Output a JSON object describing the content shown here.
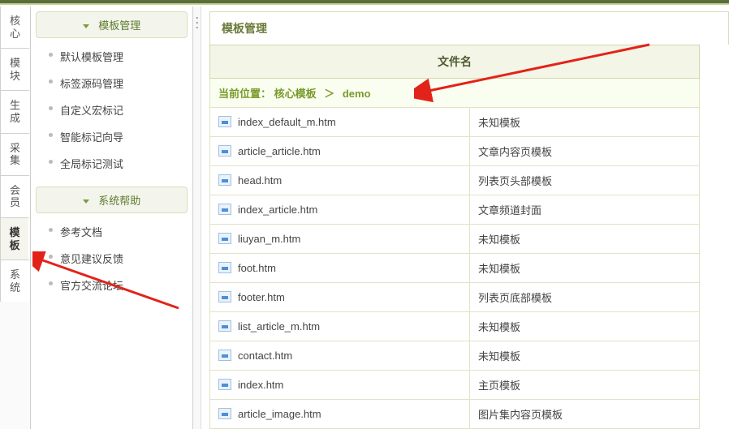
{
  "leftTabs": [
    "核心",
    "模块",
    "生成",
    "采集",
    "会员",
    "模板",
    "系统"
  ],
  "leftActiveIndex": 5,
  "templateMenu": {
    "title": "模板管理",
    "items": [
      "默认模板管理",
      "标签源码管理",
      "自定义宏标记",
      "智能标记向导",
      "全局标记测试"
    ]
  },
  "helpMenu": {
    "title": "系统帮助",
    "items": [
      "参考文档",
      "意见建议反馈",
      "官方交流论坛"
    ]
  },
  "pageTitle": "模板管理",
  "tableHeaders": [
    "文件名"
  ],
  "breadcrumb": {
    "prefix": "当前位置：",
    "parts": [
      "核心模板",
      "demo"
    ],
    "sep": "＞"
  },
  "files": [
    {
      "name": "index_default_m.htm",
      "desc": "未知模板"
    },
    {
      "name": "article_article.htm",
      "desc": "文章内容页模板"
    },
    {
      "name": "head.htm",
      "desc": "列表页头部模板"
    },
    {
      "name": "index_article.htm",
      "desc": "文章频道封面"
    },
    {
      "name": "liuyan_m.htm",
      "desc": "未知模板"
    },
    {
      "name": "foot.htm",
      "desc": "未知模板"
    },
    {
      "name": "footer.htm",
      "desc": "列表页底部模板"
    },
    {
      "name": "list_article_m.htm",
      "desc": "未知模板"
    },
    {
      "name": "contact.htm",
      "desc": "未知模板"
    },
    {
      "name": "index.htm",
      "desc": "主页模板"
    },
    {
      "name": "article_image.htm",
      "desc": "图片集内容页模板"
    }
  ]
}
